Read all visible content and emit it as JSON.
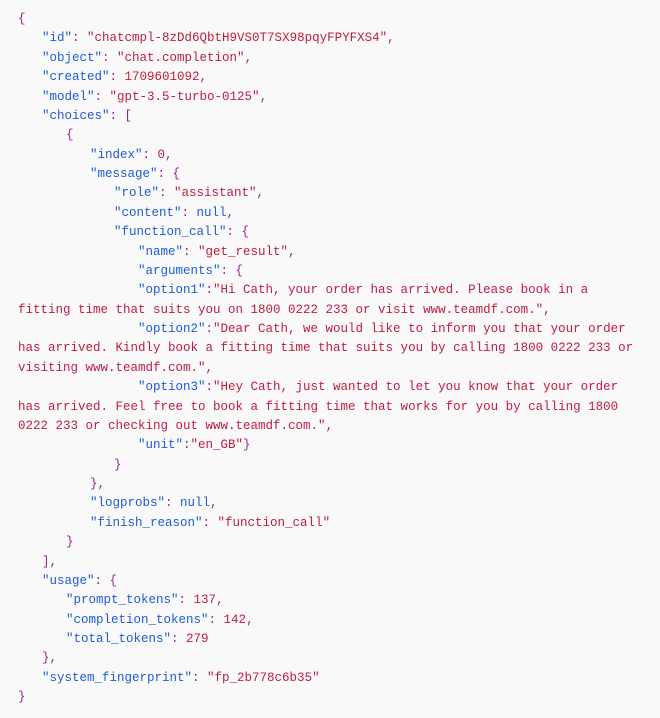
{
  "json_display": {
    "id_key": "\"id\"",
    "id_val": "\"chatcmpl-8zDd6QbtH9VS0T7SX98pqyFPYFXS4\"",
    "object_key": "\"object\"",
    "object_val": "\"chat.completion\"",
    "created_key": "\"created\"",
    "created_val": "1709601092",
    "model_key": "\"model\"",
    "model_val": "\"gpt-3.5-turbo-0125\"",
    "choices_key": "\"choices\"",
    "index_key": "\"index\"",
    "index_val": "0",
    "message_key": "\"message\"",
    "role_key": "\"role\"",
    "role_val": "\"assistant\"",
    "content_key": "\"content\"",
    "content_val": "null",
    "function_call_key": "\"function_call\"",
    "name_key": "\"name\"",
    "name_val": "\"get_result\"",
    "arguments_key": "\"arguments\"",
    "option1_key": "\"option1\"",
    "option1_val": "\"Hi Cath, your order has arrived. Please book in a fitting time that suits you on 1800 0222 233 or visit www.teamdf.com.\"",
    "option2_key": "\"option2\"",
    "option2_val": "\"Dear Cath, we would like to inform you that your order has arrived. Kindly book a fitting time that suits you by calling 1800 0222 233 or visiting www.teamdf.com.\"",
    "option3_key": "\"option3\"",
    "option3_val": "\"Hey Cath, just wanted to let you know that your order has arrived. Feel free to book a fitting time that works for you by calling 1800 0222 233 or checking out www.teamdf.com.\"",
    "unit_key": "\"unit\"",
    "unit_val": "\"en_GB\"",
    "logprobs_key": "\"logprobs\"",
    "logprobs_val": "null",
    "finish_reason_key": "\"finish_reason\"",
    "finish_reason_val": "\"function_call\"",
    "usage_key": "\"usage\"",
    "prompt_tokens_key": "\"prompt_tokens\"",
    "prompt_tokens_val": "137",
    "completion_tokens_key": "\"completion_tokens\"",
    "completion_tokens_val": "142",
    "total_tokens_key": "\"total_tokens\"",
    "total_tokens_val": "279",
    "system_fingerprint_key": "\"system_fingerprint\"",
    "system_fingerprint_val": "\"fp_2b778c6b35\""
  },
  "punct": {
    "open_brace": "{",
    "close_brace": "}",
    "open_bracket": "[",
    "close_bracket": "]",
    "colon_sp": ": ",
    "colon": ":",
    "comma": ","
  }
}
